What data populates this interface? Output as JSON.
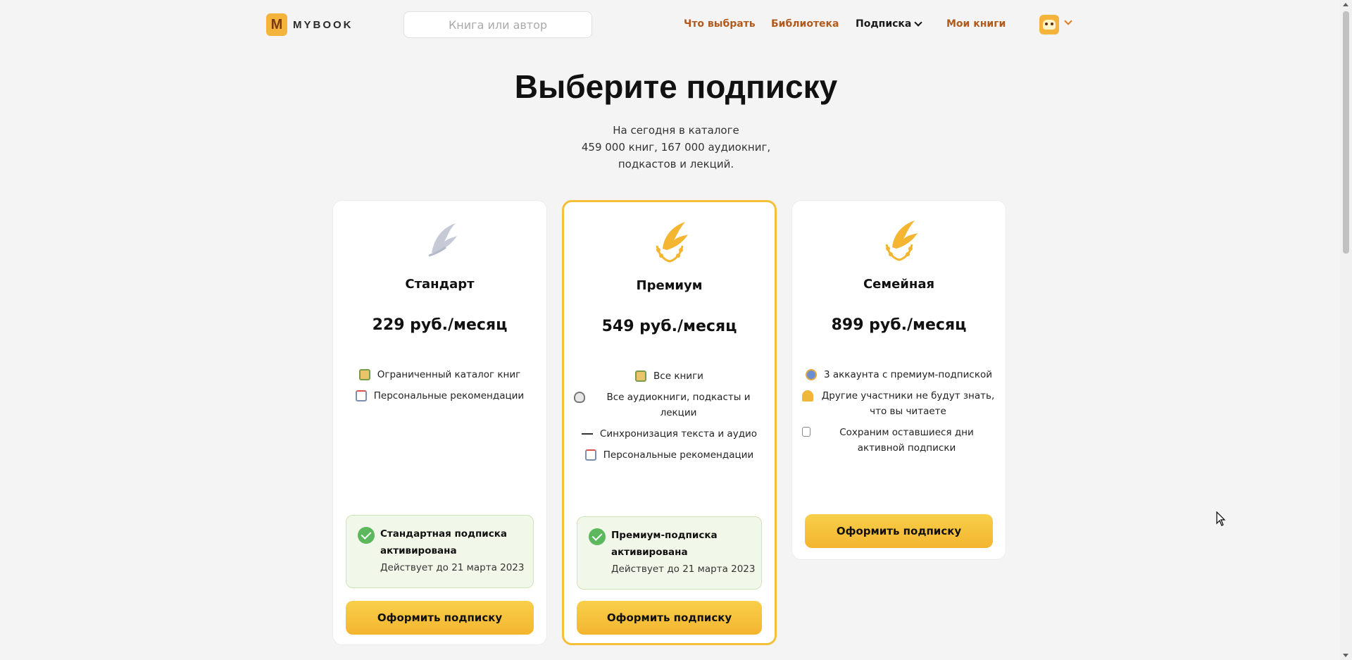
{
  "nav": {
    "logo_letter": "M",
    "logo_text": "MYBOOK",
    "search_placeholder": "Книга или автор",
    "links": [
      "Что выбрать",
      "Библиотека",
      "Подписка",
      "Мои книги"
    ]
  },
  "header": {
    "title": "Выберите подписку",
    "catalog_lines": [
      "На сегодня в каталоге",
      "459 000 книг, 167 000 аудиокниг,",
      "подкастов и лекций."
    ]
  },
  "plans": [
    {
      "icon": "silver-wing-icon",
      "title": "Стандарт",
      "price": "229 руб./месяц",
      "features": [
        {
          "icon": "book-icon",
          "text": "Ограниченный каталог книг"
        },
        {
          "icon": "envelope-icon",
          "text": "Персональные рекомендации"
        }
      ],
      "status": {
        "title": "Стандартная подписка активирована",
        "date": "Действует до 21 марта 2023"
      },
      "button": "Оформить подписку"
    },
    {
      "icon": "gold-wing-icon",
      "title": "Премиум",
      "price": "549 руб./месяц",
      "features": [
        {
          "icon": "book-icon",
          "text": "Все книги"
        },
        {
          "icon": "microphone-icon",
          "text": "Все аудиокниги, подкасты и лекции"
        },
        {
          "icon": "arrows-icon",
          "text": "Синхронизация текста и аудио"
        },
        {
          "icon": "envelope-icon",
          "text": "Персональные рекомендации"
        }
      ],
      "status": {
        "title": "Премиум-подписка активирована",
        "date": "Действует до 21 марта 2023"
      },
      "button": "Оформить подписку"
    },
    {
      "icon": "gold-wing-icon",
      "title": "Семейная",
      "price": "899 руб./месяц",
      "features": [
        {
          "icon": "family-icon",
          "text": "3 аккаунта с премиум-подпиской"
        },
        {
          "icon": "key-icon",
          "text": "Другие участники не будут знать, что вы читаете"
        },
        {
          "icon": "calendar-icon",
          "text": "Сохраним оставшиеся дни активной подписки"
        }
      ],
      "button": "Оформить подписку"
    }
  ],
  "colors": {
    "accent": "#f4b530",
    "nav_link": "#b15a1b",
    "status_bg": "#f2f8e9",
    "check": "#5cb85c"
  }
}
